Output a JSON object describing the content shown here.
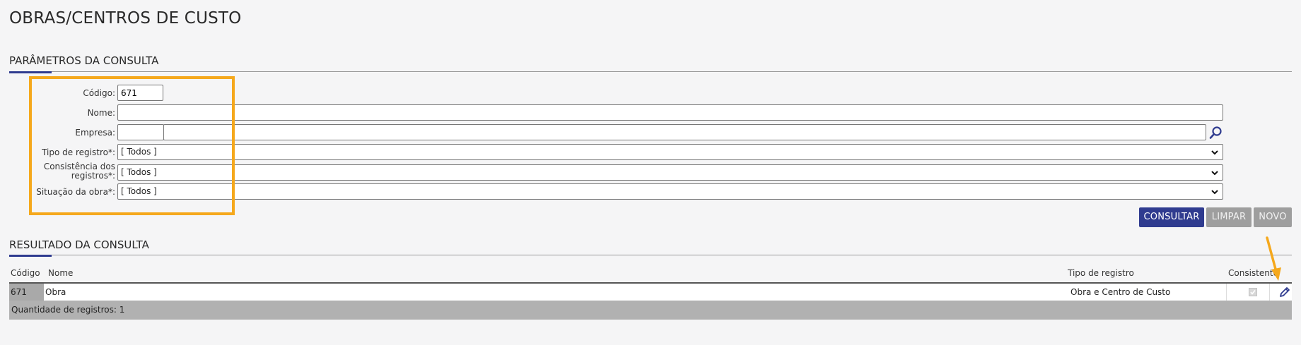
{
  "header": {
    "title": "OBRAS/CENTROS DE CUSTO"
  },
  "params": {
    "title": "PARÂMETROS DA CONSULTA",
    "codigo": {
      "label": "Código:",
      "value": "671"
    },
    "nome": {
      "label": "Nome:",
      "value": ""
    },
    "empresa": {
      "label": "Empresa:",
      "code_value": "",
      "name_value": ""
    },
    "tipo_registro": {
      "label": "Tipo de registro*:",
      "value": "[ Todos ]"
    },
    "consistencia": {
      "label_line1": "Consistência dos",
      "label_line2": "registros*:",
      "value": "[ Todos ]"
    },
    "situacao_obra": {
      "label": "Situação da obra*:",
      "value": "[ Todos ]"
    }
  },
  "actions": {
    "consultar": "CONSULTAR",
    "limpar": "LIMPAR",
    "novo": "NOVO"
  },
  "results": {
    "title": "RESULTADO DA CONSULTA",
    "columns": {
      "codigo": "Código",
      "nome": "Nome",
      "tipo": "Tipo de registro",
      "consistente": "Consistente"
    },
    "rows": [
      {
        "codigo": "671",
        "nome": "Obra",
        "tipo": "Obra e Centro de Custo",
        "consistente": true
      }
    ],
    "count_label": "Quantidade de registros: 1"
  },
  "icons": {
    "search": "search-icon",
    "edit": "edit-pencil-icon",
    "dropdown": "chevron-down-icon"
  },
  "colors": {
    "primary": "#2f3b8f",
    "highlight": "#f5a81c",
    "disabled": "#9e9e9e"
  }
}
